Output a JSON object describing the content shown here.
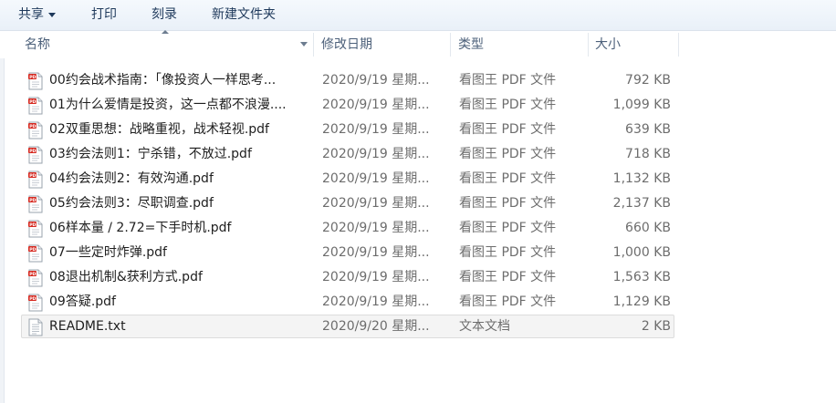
{
  "toolbar": {
    "share_label": "共享",
    "print_label": "打印",
    "burn_label": "刻录",
    "new_folder_label": "新建文件夹"
  },
  "columns": {
    "name": "名称",
    "date": "修改日期",
    "type": "类型",
    "size": "大小"
  },
  "files": [
    {
      "name": "00约会战术指南：「像投资人一样思考...",
      "date": "2020/9/19 星期...",
      "type": "看图王 PDF 文件",
      "size": "792 KB",
      "icon": "pdf-file-icon"
    },
    {
      "name": "01为什么爱情是投资，这一点都不浪漫....",
      "date": "2020/9/19 星期...",
      "type": "看图王 PDF 文件",
      "size": "1,099 KB",
      "icon": "pdf-file-icon"
    },
    {
      "name": "02双重思想：战略重视，战术轻视.pdf",
      "date": "2020/9/19 星期...",
      "type": "看图王 PDF 文件",
      "size": "639 KB",
      "icon": "pdf-file-icon"
    },
    {
      "name": "03约会法则1：宁杀错，不放过.pdf",
      "date": "2020/9/19 星期...",
      "type": "看图王 PDF 文件",
      "size": "718 KB",
      "icon": "pdf-file-icon"
    },
    {
      "name": "04约会法则2：有效沟通.pdf",
      "date": "2020/9/19 星期...",
      "type": "看图王 PDF 文件",
      "size": "1,132 KB",
      "icon": "pdf-file-icon"
    },
    {
      "name": "05约会法则3：尽职调查.pdf",
      "date": "2020/9/19 星期...",
      "type": "看图王 PDF 文件",
      "size": "2,137 KB",
      "icon": "pdf-file-icon"
    },
    {
      "name": "06样本量 / 2.72=下手时机.pdf",
      "date": "2020/9/19 星期...",
      "type": "看图王 PDF 文件",
      "size": "660 KB",
      "icon": "pdf-file-icon"
    },
    {
      "name": "07一些定时炸弹.pdf",
      "date": "2020/9/19 星期...",
      "type": "看图王 PDF 文件",
      "size": "1,000 KB",
      "icon": "pdf-file-icon"
    },
    {
      "name": "08退出机制&获利方式.pdf",
      "date": "2020/9/19 星期...",
      "type": "看图王 PDF 文件",
      "size": "1,563 KB",
      "icon": "pdf-file-icon"
    },
    {
      "name": "09答疑.pdf",
      "date": "2020/9/19 星期...",
      "type": "看图王 PDF 文件",
      "size": "1,129 KB",
      "icon": "pdf-file-icon"
    },
    {
      "name": "README.txt",
      "date": "2020/9/20 星期...",
      "type": "文本文档",
      "size": "2 KB",
      "icon": "text-file-icon",
      "selected": true
    }
  ],
  "colors": {
    "toolbar_text": "#1e395b",
    "header_text": "#4c607a",
    "secondary_text": "#6d6d6d",
    "pdf_red": "#d6281f"
  }
}
